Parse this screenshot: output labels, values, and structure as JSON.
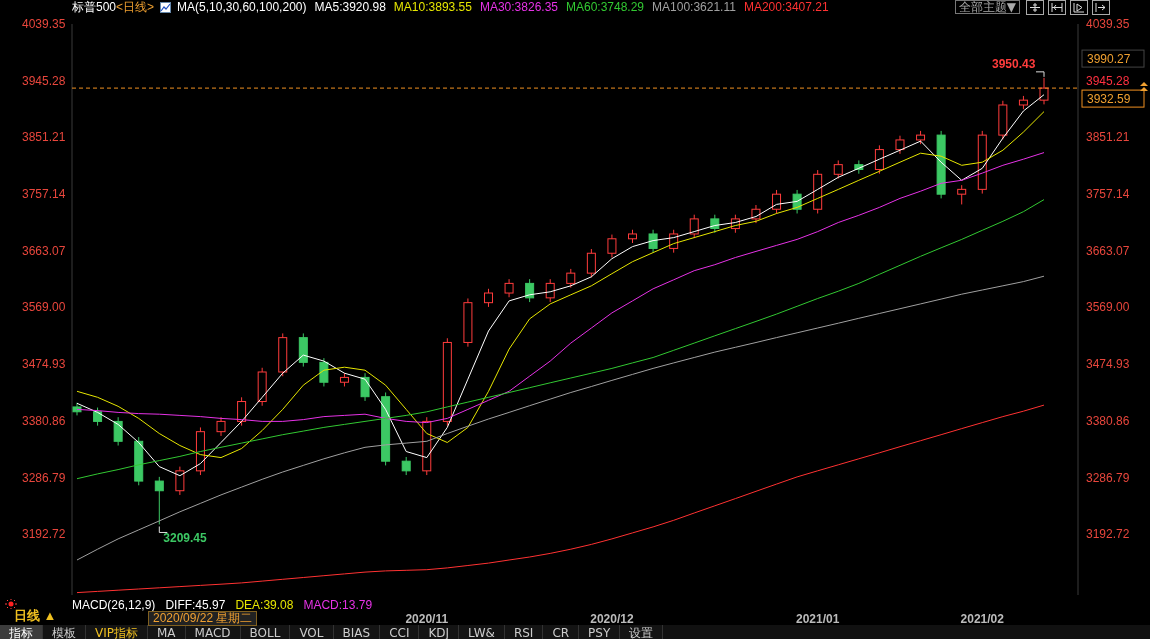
{
  "header": {
    "symbol": "标普500",
    "period": "<日线>",
    "indicator": "MA(5,10,30,60,100,200)",
    "values": [
      {
        "label": "MA5:3920.98",
        "color": "#ffffff"
      },
      {
        "label": "MA10:3893.55",
        "color": "#e6e600"
      },
      {
        "label": "MA30:3826.35",
        "color": "#e632e6"
      },
      {
        "label": "MA60:3748.29",
        "color": "#32c832"
      },
      {
        "label": "MA100:3621.11",
        "color": "#a0a0a0"
      },
      {
        "label": "MA200:3407.21",
        "color": "#ff3232"
      }
    ],
    "theme_button": "全部主题▼"
  },
  "candles": {
    "chart_data": {
      "type": "candlestick",
      "categories": [
        null,
        null,
        null,
        null,
        null,
        null,
        null,
        null,
        null,
        null,
        null,
        null,
        null,
        null,
        null,
        null,
        null,
        "2020/11",
        null,
        null,
        null,
        null,
        null,
        null,
        null,
        null,
        "2020/12",
        null,
        null,
        null,
        null,
        null,
        null,
        null,
        null,
        null,
        "2021/01",
        null,
        null,
        null,
        null,
        null,
        null,
        null,
        "2021/02",
        null,
        null,
        null
      ],
      "ylim": [
        3092,
        4039.35
      ],
      "yticks": [
        {
          "value": 4039.35,
          "label": "4039.35"
        },
        {
          "value": 3945.28,
          "label": "3945.28"
        },
        {
          "value": 3851.21,
          "label": "3851.21"
        },
        {
          "value": 3757.14,
          "label": "3757.14"
        },
        {
          "value": 3663.07,
          "label": "3663.07"
        },
        {
          "value": 3569.0,
          "label": "3569.00"
        },
        {
          "value": 3474.93,
          "label": "3474.93"
        },
        {
          "value": 3380.86,
          "label": "3380.86"
        },
        {
          "value": 3286.79,
          "label": "3286.79"
        },
        {
          "value": 3192.72,
          "label": "3192.72"
        }
      ],
      "ohlc": [
        [
          3404,
          3411,
          3390,
          3396
        ],
        [
          3396,
          3403,
          3373,
          3380
        ],
        [
          3380,
          3387,
          3340,
          3347
        ],
        [
          3347,
          3354,
          3274,
          3281
        ],
        [
          3281,
          3288,
          3209,
          3265
        ],
        [
          3265,
          3305,
          3258,
          3298
        ],
        [
          3298,
          3370,
          3291,
          3363
        ],
        [
          3363,
          3387,
          3356,
          3380
        ],
        [
          3380,
          3420,
          3373,
          3413
        ],
        [
          3413,
          3469,
          3406,
          3462
        ],
        [
          3462,
          3526,
          3455,
          3519
        ],
        [
          3519,
          3526,
          3471,
          3478
        ],
        [
          3478,
          3485,
          3438,
          3445
        ],
        [
          3445,
          3460,
          3438,
          3453
        ],
        [
          3453,
          3460,
          3414,
          3421
        ],
        [
          3421,
          3428,
          3307,
          3314
        ],
        [
          3314,
          3321,
          3291,
          3298
        ],
        [
          3298,
          3387,
          3291,
          3380
        ],
        [
          3380,
          3518,
          3373,
          3511
        ],
        [
          3511,
          3584,
          3504,
          3577
        ],
        [
          3577,
          3600,
          3570,
          3593
        ],
        [
          3593,
          3616,
          3586,
          3609
        ],
        [
          3609,
          3616,
          3578,
          3585
        ],
        [
          3585,
          3616,
          3578,
          3609
        ],
        [
          3609,
          3633,
          3602,
          3626
        ],
        [
          3626,
          3666,
          3619,
          3659
        ],
        [
          3659,
          3690,
          3652,
          3683
        ],
        [
          3683,
          3698,
          3676,
          3691
        ],
        [
          3691,
          3698,
          3660,
          3667
        ],
        [
          3667,
          3698,
          3660,
          3691
        ],
        [
          3691,
          3723,
          3684,
          3716
        ],
        [
          3716,
          3723,
          3693,
          3700
        ],
        [
          3700,
          3723,
          3693,
          3716
        ],
        [
          3716,
          3739,
          3709,
          3732
        ],
        [
          3732,
          3764,
          3725,
          3757
        ],
        [
          3757,
          3764,
          3725,
          3732
        ],
        [
          3732,
          3797,
          3725,
          3790
        ],
        [
          3790,
          3813,
          3783,
          3806
        ],
        [
          3806,
          3813,
          3791,
          3798
        ],
        [
          3798,
          3838,
          3791,
          3831
        ],
        [
          3831,
          3854,
          3824,
          3847
        ],
        [
          3847,
          3862,
          3840,
          3855
        ],
        [
          3855,
          3862,
          3750,
          3757
        ],
        [
          3757,
          3772,
          3740,
          3765
        ],
        [
          3765,
          3862,
          3758,
          3855
        ],
        [
          3855,
          3912,
          3848,
          3905
        ],
        [
          3905,
          3920,
          3898,
          3913
        ],
        [
          3913,
          3950,
          3906,
          3933
        ]
      ],
      "annotations": [
        "3950.43",
        "3209.45"
      ]
    }
  },
  "averages": {
    "chart_data": {
      "type": "line",
      "categories": [
        null,
        null,
        null,
        null,
        null,
        null,
        null,
        null,
        null,
        null,
        null,
        null,
        null,
        null,
        null,
        null,
        null,
        null,
        null,
        null,
        null,
        null,
        null,
        null,
        null,
        null,
        null,
        null,
        null,
        null,
        null,
        null,
        null,
        null,
        null,
        null,
        null,
        null,
        null,
        null,
        null,
        null,
        null,
        null,
        null,
        null,
        null,
        null
      ],
      "ylim": [
        3092,
        4039.35
      ],
      "yticks": [
        {
          "value": 4039.35,
          "label": "4039.35"
        },
        {
          "value": 3945.28,
          "label": "3945.28"
        },
        {
          "value": 3851.21,
          "label": "3851.21"
        },
        {
          "value": 3757.14,
          "label": "3757.14"
        },
        {
          "value": 3663.07,
          "label": "3663.07"
        },
        {
          "value": 3569.0,
          "label": "3569.00"
        },
        {
          "value": 3474.93,
          "label": "3474.93"
        },
        {
          "value": 3380.86,
          "label": "3380.86"
        },
        {
          "value": 3286.79,
          "label": "3286.79"
        },
        {
          "value": 3192.72,
          "label": "3192.72"
        }
      ],
      "series": [
        {
          "color": "#ffffff",
          "values": [
            3410,
            3395,
            3375,
            3345,
            3305,
            3290,
            3310,
            3345,
            3380,
            3420,
            3460,
            3490,
            3480,
            3460,
            3450,
            3400,
            3330,
            3320,
            3370,
            3450,
            3530,
            3580,
            3590,
            3595,
            3605,
            3620,
            3650,
            3670,
            3680,
            3685,
            3695,
            3705,
            3710,
            3720,
            3740,
            3745,
            3765,
            3785,
            3800,
            3815,
            3830,
            3845,
            3810,
            3780,
            3800,
            3850,
            3895,
            3922
          ]
        },
        {
          "color": "#e6e600",
          "values": [
            3430,
            3420,
            3405,
            3385,
            3360,
            3340,
            3325,
            3320,
            3335,
            3365,
            3400,
            3440,
            3465,
            3470,
            3465,
            3440,
            3400,
            3360,
            3345,
            3370,
            3430,
            3500,
            3550,
            3575,
            3590,
            3605,
            3625,
            3645,
            3660,
            3675,
            3685,
            3695,
            3705,
            3712,
            3725,
            3735,
            3750,
            3765,
            3780,
            3795,
            3810,
            3825,
            3820,
            3805,
            3810,
            3830,
            3860,
            3894
          ]
        },
        {
          "color": "#e632e6",
          "values": [
            3400,
            3398,
            3395,
            3393,
            3392,
            3390,
            3388,
            3385,
            3383,
            3380,
            3380,
            3383,
            3388,
            3390,
            3392,
            3385,
            3380,
            3378,
            3385,
            3400,
            3415,
            3430,
            3455,
            3480,
            3510,
            3535,
            3560,
            3580,
            3600,
            3615,
            3630,
            3640,
            3652,
            3662,
            3672,
            3682,
            3695,
            3710,
            3722,
            3735,
            3750,
            3762,
            3775,
            3780,
            3792,
            3805,
            3815,
            3826
          ]
        },
        {
          "color": "#32c832",
          "values": [
            3285,
            3293,
            3300,
            3308,
            3315,
            3322,
            3330,
            3337,
            3344,
            3351,
            3358,
            3364,
            3370,
            3375,
            3380,
            3385,
            3390,
            3396,
            3404,
            3412,
            3420,
            3428,
            3436,
            3444,
            3452,
            3460,
            3468,
            3477,
            3486,
            3498,
            3510,
            3522,
            3534,
            3546,
            3558,
            3571,
            3584,
            3596,
            3609,
            3624,
            3639,
            3654,
            3668,
            3682,
            3697,
            3712,
            3728,
            3748
          ]
        },
        {
          "color": "#a0a0a0",
          "values": [
            3150,
            3168,
            3185,
            3200,
            3215,
            3230,
            3244,
            3258,
            3271,
            3284,
            3296,
            3307,
            3318,
            3328,
            3337,
            3341,
            3344,
            3347,
            3360,
            3372,
            3384,
            3395,
            3406,
            3417,
            3428,
            3438,
            3448,
            3458,
            3468,
            3477,
            3486,
            3495,
            3503,
            3511,
            3519,
            3527,
            3535,
            3543,
            3551,
            3559,
            3567,
            3575,
            3583,
            3591,
            3598,
            3605,
            3612,
            3621
          ]
        },
        {
          "color": "#ff3232",
          "values": [
            3096,
            3098,
            3100,
            3102,
            3104,
            3106,
            3108,
            3110,
            3112,
            3115,
            3118,
            3121,
            3124,
            3127,
            3130,
            3132,
            3133,
            3134,
            3137,
            3141,
            3145,
            3150,
            3155,
            3161,
            3168,
            3176,
            3185,
            3195,
            3205,
            3216,
            3228,
            3240,
            3252,
            3264,
            3276,
            3288,
            3298,
            3308,
            3318,
            3328,
            3338,
            3348,
            3358,
            3368,
            3378,
            3388,
            3397,
            3407
          ]
        }
      ]
    }
  },
  "price_boxes": [
    {
      "label": "3990.27",
      "kind": "high"
    },
    {
      "label": "3932.59",
      "kind": "current"
    }
  ],
  "macd": {
    "period": "日线 ▲",
    "legend": [
      {
        "label": "MACD(26,12,9)",
        "color": "#ffffff"
      },
      {
        "label": "DIFF:45.97",
        "color": "#ffffff"
      },
      {
        "label": "DEA:39.08",
        "color": "#e6e600"
      },
      {
        "label": "MACD:13.79",
        "color": "#e632e6"
      }
    ],
    "date_tooltip": "2020/09/22 星期二"
  },
  "tabs": [
    {
      "label": "指标",
      "selected": true,
      "kind": "plain"
    },
    {
      "label": "模板",
      "selected": false,
      "kind": "plain"
    },
    {
      "label": "VIP指标",
      "selected": false,
      "kind": "vip"
    },
    {
      "label": "MA",
      "selected": false,
      "kind": "plain"
    },
    {
      "label": "MACD",
      "selected": false,
      "kind": "plain"
    },
    {
      "label": "BOLL",
      "selected": false,
      "kind": "plain"
    },
    {
      "label": "VOL",
      "selected": false,
      "kind": "plain"
    },
    {
      "label": "BIAS",
      "selected": false,
      "kind": "plain"
    },
    {
      "label": "CCI",
      "selected": false,
      "kind": "plain"
    },
    {
      "label": "KDJ",
      "selected": false,
      "kind": "plain"
    },
    {
      "label": "LW&",
      "selected": false,
      "kind": "plain"
    },
    {
      "label": "RSI",
      "selected": false,
      "kind": "plain"
    },
    {
      "label": "CR",
      "selected": false,
      "kind": "plain"
    },
    {
      "label": "PSY",
      "selected": false,
      "kind": "plain"
    },
    {
      "label": "设置",
      "selected": false,
      "kind": "plain"
    }
  ]
}
